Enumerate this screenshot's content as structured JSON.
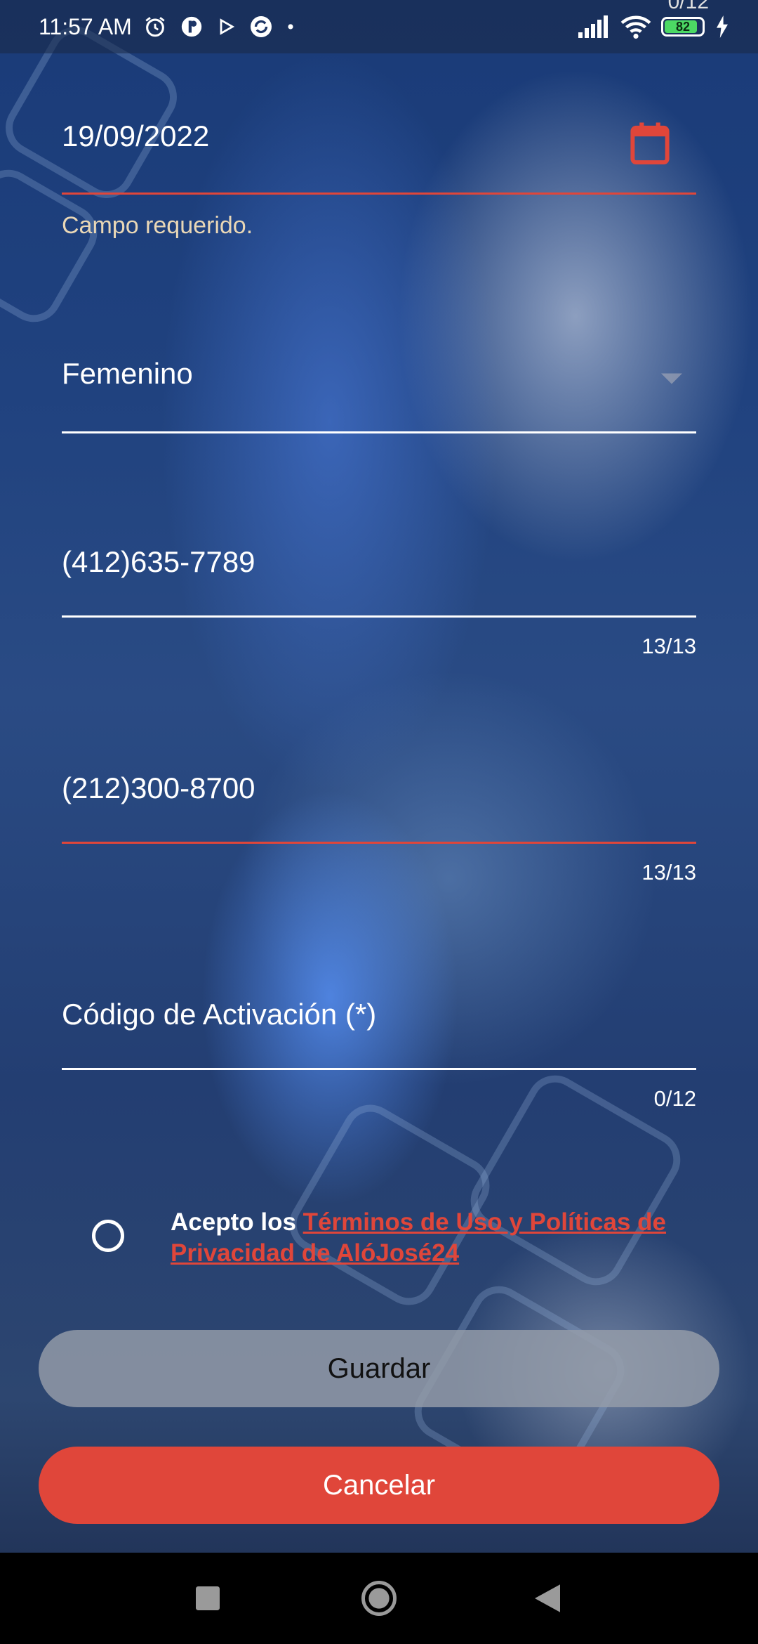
{
  "status_bar": {
    "time": "11:57 AM",
    "battery": "82",
    "top_counter": "0/12"
  },
  "form": {
    "date": {
      "value": "19/09/2022",
      "error": "Campo requerido."
    },
    "gender": {
      "value": "Femenino"
    },
    "phone1": {
      "value": "(412)635-7789",
      "counter": "13/13"
    },
    "phone2": {
      "value": "(212)300-8700",
      "counter": "13/13"
    },
    "activation_code": {
      "placeholder": "Código de Activación (*)",
      "counter": "0/12"
    },
    "terms": {
      "prefix": "Acepto los ",
      "link": "Términos de Uso y Políticas de Privacidad de AlóJosé24"
    },
    "buttons": {
      "save": "Guardar",
      "cancel": "Cancelar"
    }
  },
  "colors": {
    "accent": "#e0463a",
    "save_button": "#969eaa",
    "navbar": "#000000"
  },
  "icons": [
    "alarm-icon",
    "app-icon",
    "play-icon",
    "sync-icon",
    "signal-icon",
    "wifi-icon",
    "battery-icon",
    "charging-icon",
    "calendar-icon",
    "dropdown-arrow-icon",
    "recents-icon",
    "home-icon",
    "back-icon"
  ]
}
